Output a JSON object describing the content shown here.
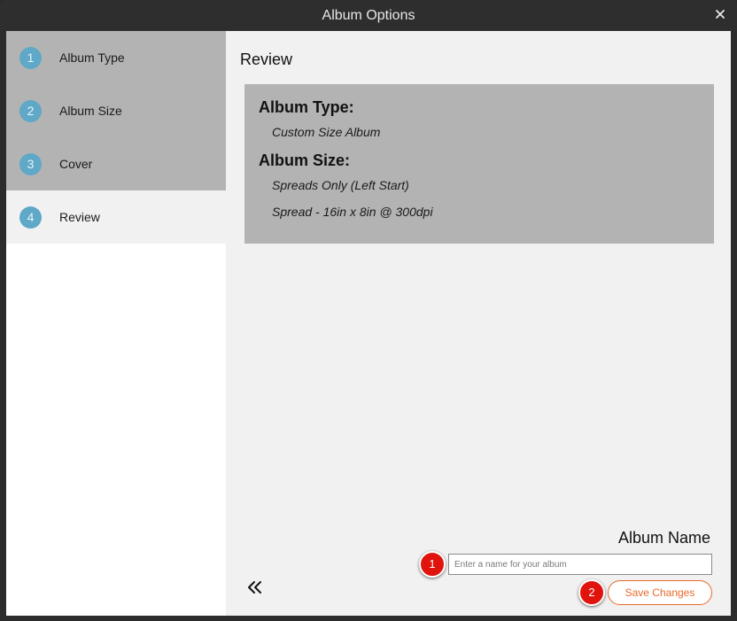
{
  "window": {
    "title": "Album Options"
  },
  "sidebar": {
    "steps": [
      {
        "number": "1",
        "label": "Album Type"
      },
      {
        "number": "2",
        "label": "Album Size"
      },
      {
        "number": "3",
        "label": "Cover"
      },
      {
        "number": "4",
        "label": "Review"
      }
    ],
    "active_step": "4"
  },
  "review": {
    "title": "Review",
    "album_type_heading": "Album Type:",
    "album_type_value": "Custom Size Album",
    "album_size_heading": "Album Size:",
    "album_size_value_1": "Spreads Only (Left Start)",
    "album_size_value_2": "Spread - 16in x 8in @ 300dpi"
  },
  "album_name": {
    "label": "Album Name",
    "placeholder": "Enter a name for your album",
    "value": ""
  },
  "buttons": {
    "save_label": "Save Changes"
  },
  "callouts": [
    "1",
    "2"
  ],
  "icons": {
    "close": "close-icon",
    "back": "double-chevron-left-icon"
  },
  "colors": {
    "accent": "#e76a2b",
    "step_circle": "#5fa8c8",
    "callout": "#e0140c"
  }
}
